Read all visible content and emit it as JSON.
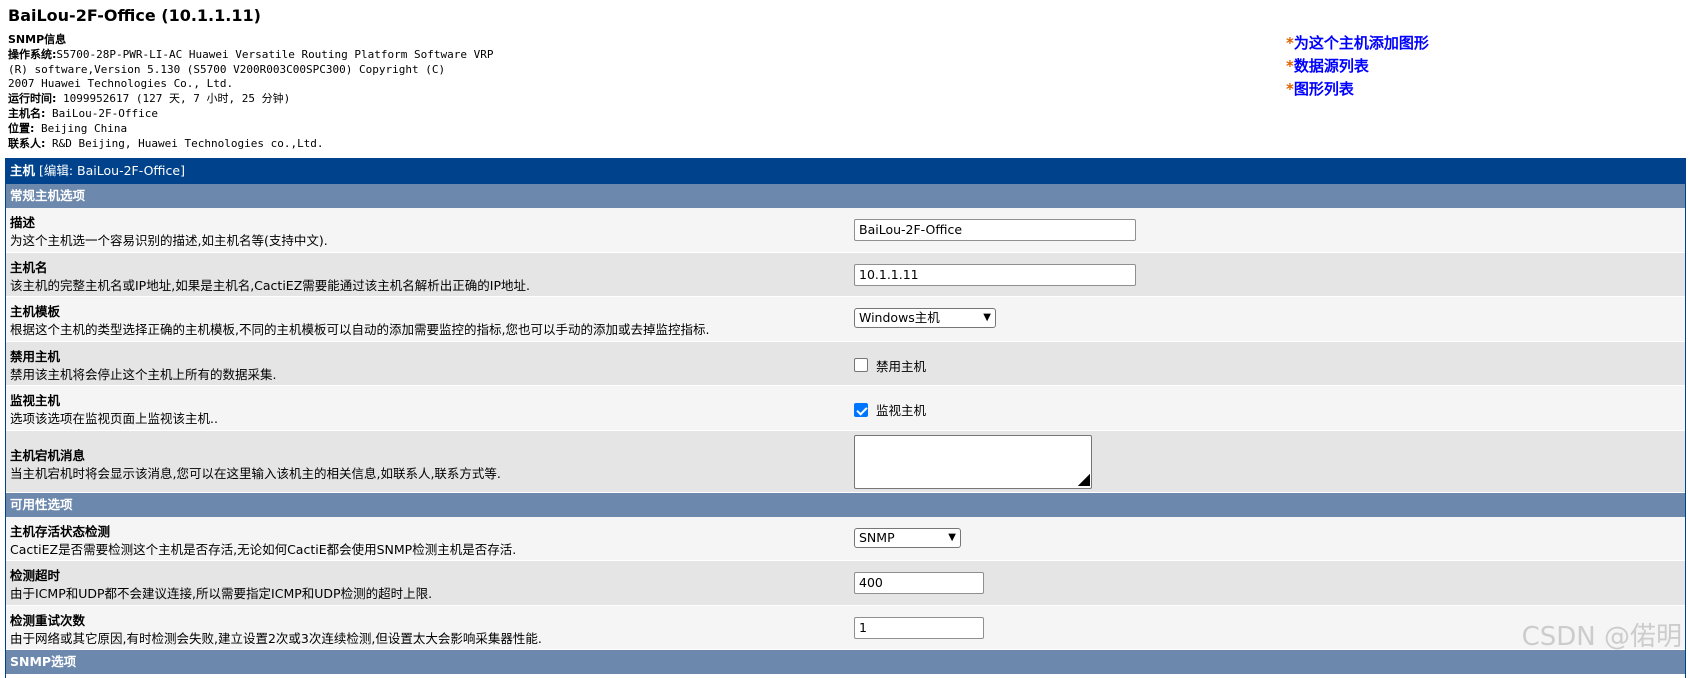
{
  "page": {
    "title": "BaiLou-2F-Office (10.1.1.11)"
  },
  "snmp_info": {
    "heading": "SNMP信息",
    "os_label": "操作系统:",
    "os_line1": "S5700-28P-PWR-LI-AC Huawei Versatile Routing Platform Software VRP",
    "os_line2": "(R) software,Version 5.130 (S5700 V200R003C00SPC300) Copyright (C)",
    "os_line3": "2007 Huawei Technologies Co., Ltd.",
    "uptime_label": "运行时间:",
    "uptime_value": " 1099952617  (127 天, 7 小时, 25 分钟)",
    "hostname_label": "主机名:",
    "hostname_value": " BaiLou-2F-Office",
    "location_label": "位置:",
    "location_value": " Beijing China",
    "contact_label": "联系人:",
    "contact_value": " R&D Beijing, Huawei Technologies co.,Ltd."
  },
  "actions": {
    "star": "*",
    "add_graph": "为这个主机添加图形",
    "data_sources": "数据源列表",
    "graph_list": "图形列表"
  },
  "main_bar": {
    "label": "主机",
    "edit": " [编辑: BaiLou-2F-Office]"
  },
  "sections": {
    "general": "常规主机选项",
    "availability": "可用性选项",
    "snmp": "SNMP选项"
  },
  "fields": {
    "description": {
      "name": "描述",
      "help": "为这个主机选一个容易识别的描述,如主机名等(支持中文).",
      "value": "BaiLou-2F-Office"
    },
    "hostname": {
      "name": "主机名",
      "help": "该主机的完整主机名或IP地址,如果是主机名,CactiEZ需要能通过该主机名解析出正确的IP地址.",
      "value": "10.1.1.11"
    },
    "template": {
      "name": "主机模板",
      "help": "根据这个主机的类型选择正确的主机模板,不同的主机模板可以自动的添加需要监控的指标,您也可以手动的添加或去掉监控指标.",
      "value": "Windows主机"
    },
    "disable": {
      "name": "禁用主机",
      "help": "禁用该主机将会停止这个主机上所有的数据采集.",
      "checkbox_label": "禁用主机",
      "checked": false
    },
    "monitor": {
      "name": "监视主机",
      "help": "选项该选项在监视页面上监视该主机..",
      "checkbox_label": "监视主机",
      "checked": true
    },
    "down_message": {
      "name": "主机宕机消息",
      "help": "当主机宕机时将会显示该消息,您可以在这里输入该机主的相关信息,如联系人,联系方式等.",
      "value": ""
    },
    "alive_check": {
      "name": "主机存活状态检测",
      "help": "CactiEZ是否需要检测这个主机是否存活,无论如何CactiE都会使用SNMP检测主机是否存活.",
      "value": "SNMP"
    },
    "timeout": {
      "name": "检测超时",
      "help": "由于ICMP和UDP都不会建议连接,所以需要指定ICMP和UDP检测的超时上限.",
      "value": "400"
    },
    "retries": {
      "name": "检测重试次数",
      "help": "由于网络或其它原因,有时检测会失败,建立设置2次或3次连续检测,但设置太大会影响采集器性能.",
      "value": "1"
    }
  },
  "watermark": "CSDN @偌明"
}
